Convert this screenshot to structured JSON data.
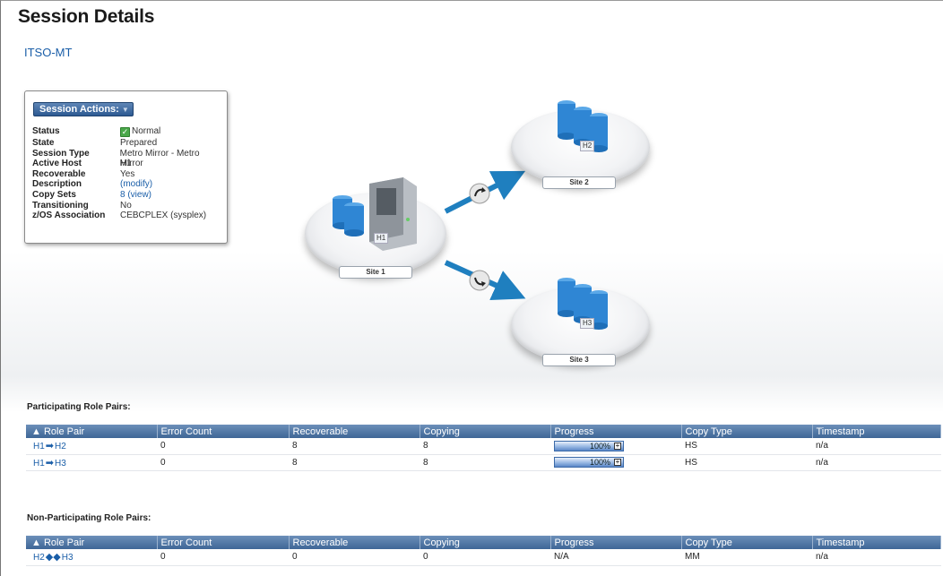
{
  "page": {
    "title": "Session Details",
    "session_name": "ITSO-MT"
  },
  "session_panel": {
    "actions_label": "Session Actions:",
    "properties": [
      {
        "key": "Status",
        "value": "Normal"
      },
      {
        "key": "State",
        "value": "Prepared"
      },
      {
        "key": "Session Type",
        "value": "Metro Mirror - Metro Mirror"
      },
      {
        "key": "Active Host",
        "value": "H1"
      },
      {
        "key": "Recoverable",
        "value": "Yes"
      },
      {
        "key": "Description",
        "value": "(modify)"
      },
      {
        "key": "Copy Sets",
        "value": "8 (view)"
      },
      {
        "key": "Transitioning",
        "value": "No"
      },
      {
        "key": "z/OS Association",
        "value": "CEBCPLEX (sysplex)"
      }
    ]
  },
  "topology": {
    "sites": [
      {
        "name": "Site 1",
        "host": "H1"
      },
      {
        "name": "Site 2",
        "host": "H2"
      },
      {
        "name": "Site 3",
        "host": "H3"
      }
    ]
  },
  "participating": {
    "title": "Participating Role Pairs:",
    "columns": [
      "Role Pair",
      "Error Count",
      "Recoverable",
      "Copying",
      "Progress",
      "Copy Type",
      "Timestamp"
    ],
    "rows": [
      {
        "from": "H1",
        "to": "H2",
        "error_count": "0",
        "recoverable": "8",
        "copying": "8",
        "progress": "100%",
        "progress_value": 100,
        "copy_type": "HS",
        "timestamp": "n/a"
      },
      {
        "from": "H1",
        "to": "H3",
        "error_count": "0",
        "recoverable": "8",
        "copying": "8",
        "progress": "100%",
        "progress_value": 100,
        "copy_type": "HS",
        "timestamp": "n/a"
      }
    ]
  },
  "non_participating": {
    "title": "Non-Participating Role Pairs:",
    "columns": [
      "Role Pair",
      "Error Count",
      "Recoverable",
      "Copying",
      "Progress",
      "Copy Type",
      "Timestamp"
    ],
    "rows": [
      {
        "from": "H2",
        "to": "H3",
        "error_count": "0",
        "recoverable": "0",
        "copying": "0",
        "progress": "N/A",
        "copy_type": "MM",
        "timestamp": "n/a"
      }
    ]
  },
  "colors": {
    "link": "#1a5ea8",
    "header_blue": "#3e6696",
    "status_ok": "#4aa84a",
    "arrow": "#1f7fbf"
  }
}
